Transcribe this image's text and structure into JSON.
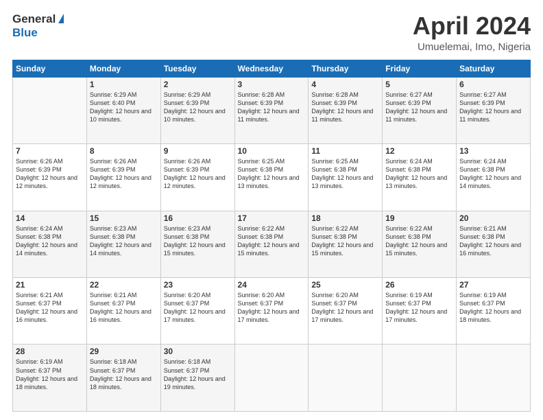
{
  "header": {
    "logo_general": "General",
    "logo_blue": "Blue",
    "month_title": "April 2024",
    "location": "Umuelemai, Imo, Nigeria"
  },
  "days_of_week": [
    "Sunday",
    "Monday",
    "Tuesday",
    "Wednesday",
    "Thursday",
    "Friday",
    "Saturday"
  ],
  "weeks": [
    [
      {
        "day": "",
        "sunrise": "",
        "sunset": "",
        "daylight": ""
      },
      {
        "day": "1",
        "sunrise": "6:29 AM",
        "sunset": "6:40 PM",
        "daylight": "12 hours and 10 minutes."
      },
      {
        "day": "2",
        "sunrise": "6:29 AM",
        "sunset": "6:39 PM",
        "daylight": "12 hours and 10 minutes."
      },
      {
        "day": "3",
        "sunrise": "6:28 AM",
        "sunset": "6:39 PM",
        "daylight": "12 hours and 11 minutes."
      },
      {
        "day": "4",
        "sunrise": "6:28 AM",
        "sunset": "6:39 PM",
        "daylight": "12 hours and 11 minutes."
      },
      {
        "day": "5",
        "sunrise": "6:27 AM",
        "sunset": "6:39 PM",
        "daylight": "12 hours and 11 minutes."
      },
      {
        "day": "6",
        "sunrise": "6:27 AM",
        "sunset": "6:39 PM",
        "daylight": "12 hours and 11 minutes."
      }
    ],
    [
      {
        "day": "7",
        "sunrise": "6:26 AM",
        "sunset": "6:39 PM",
        "daylight": "12 hours and 12 minutes."
      },
      {
        "day": "8",
        "sunrise": "6:26 AM",
        "sunset": "6:39 PM",
        "daylight": "12 hours and 12 minutes."
      },
      {
        "day": "9",
        "sunrise": "6:26 AM",
        "sunset": "6:39 PM",
        "daylight": "12 hours and 12 minutes."
      },
      {
        "day": "10",
        "sunrise": "6:25 AM",
        "sunset": "6:38 PM",
        "daylight": "12 hours and 13 minutes."
      },
      {
        "day": "11",
        "sunrise": "6:25 AM",
        "sunset": "6:38 PM",
        "daylight": "12 hours and 13 minutes."
      },
      {
        "day": "12",
        "sunrise": "6:24 AM",
        "sunset": "6:38 PM",
        "daylight": "12 hours and 13 minutes."
      },
      {
        "day": "13",
        "sunrise": "6:24 AM",
        "sunset": "6:38 PM",
        "daylight": "12 hours and 14 minutes."
      }
    ],
    [
      {
        "day": "14",
        "sunrise": "6:24 AM",
        "sunset": "6:38 PM",
        "daylight": "12 hours and 14 minutes."
      },
      {
        "day": "15",
        "sunrise": "6:23 AM",
        "sunset": "6:38 PM",
        "daylight": "12 hours and 14 minutes."
      },
      {
        "day": "16",
        "sunrise": "6:23 AM",
        "sunset": "6:38 PM",
        "daylight": "12 hours and 15 minutes."
      },
      {
        "day": "17",
        "sunrise": "6:22 AM",
        "sunset": "6:38 PM",
        "daylight": "12 hours and 15 minutes."
      },
      {
        "day": "18",
        "sunrise": "6:22 AM",
        "sunset": "6:38 PM",
        "daylight": "12 hours and 15 minutes."
      },
      {
        "day": "19",
        "sunrise": "6:22 AM",
        "sunset": "6:38 PM",
        "daylight": "12 hours and 15 minutes."
      },
      {
        "day": "20",
        "sunrise": "6:21 AM",
        "sunset": "6:38 PM",
        "daylight": "12 hours and 16 minutes."
      }
    ],
    [
      {
        "day": "21",
        "sunrise": "6:21 AM",
        "sunset": "6:37 PM",
        "daylight": "12 hours and 16 minutes."
      },
      {
        "day": "22",
        "sunrise": "6:21 AM",
        "sunset": "6:37 PM",
        "daylight": "12 hours and 16 minutes."
      },
      {
        "day": "23",
        "sunrise": "6:20 AM",
        "sunset": "6:37 PM",
        "daylight": "12 hours and 17 minutes."
      },
      {
        "day": "24",
        "sunrise": "6:20 AM",
        "sunset": "6:37 PM",
        "daylight": "12 hours and 17 minutes."
      },
      {
        "day": "25",
        "sunrise": "6:20 AM",
        "sunset": "6:37 PM",
        "daylight": "12 hours and 17 minutes."
      },
      {
        "day": "26",
        "sunrise": "6:19 AM",
        "sunset": "6:37 PM",
        "daylight": "12 hours and 17 minutes."
      },
      {
        "day": "27",
        "sunrise": "6:19 AM",
        "sunset": "6:37 PM",
        "daylight": "12 hours and 18 minutes."
      }
    ],
    [
      {
        "day": "28",
        "sunrise": "6:19 AM",
        "sunset": "6:37 PM",
        "daylight": "12 hours and 18 minutes."
      },
      {
        "day": "29",
        "sunrise": "6:18 AM",
        "sunset": "6:37 PM",
        "daylight": "12 hours and 18 minutes."
      },
      {
        "day": "30",
        "sunrise": "6:18 AM",
        "sunset": "6:37 PM",
        "daylight": "12 hours and 19 minutes."
      },
      {
        "day": "",
        "sunrise": "",
        "sunset": "",
        "daylight": ""
      },
      {
        "day": "",
        "sunrise": "",
        "sunset": "",
        "daylight": ""
      },
      {
        "day": "",
        "sunrise": "",
        "sunset": "",
        "daylight": ""
      },
      {
        "day": "",
        "sunrise": "",
        "sunset": "",
        "daylight": ""
      }
    ]
  ],
  "labels": {
    "sunrise_prefix": "Sunrise: ",
    "sunset_prefix": "Sunset: ",
    "daylight_prefix": "Daylight: "
  }
}
